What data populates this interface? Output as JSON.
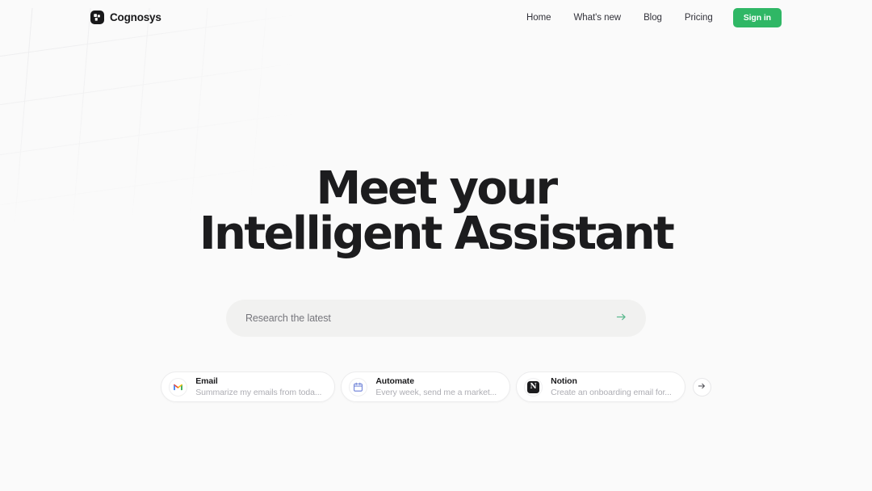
{
  "brand": {
    "name": "Cognosys",
    "logo_icon": "cognosys-pinwheel-icon"
  },
  "nav": {
    "links": [
      {
        "label": "Home"
      },
      {
        "label": "What's new"
      },
      {
        "label": "Blog"
      },
      {
        "label": "Pricing"
      }
    ],
    "signin_label": "Sign in",
    "signin_color": "#2fb765"
  },
  "hero": {
    "headline": "Meet your Intelligent Assistant"
  },
  "search": {
    "placeholder": "Research the latest",
    "value": "",
    "submit_icon": "arrow-right-icon",
    "submit_color": "#5cb98e",
    "background": "#f1f1f0"
  },
  "suggestions": {
    "cards": [
      {
        "icon": "gmail-icon",
        "title": "Email",
        "subtitle": "Summarize my emails from toda..."
      },
      {
        "icon": "calendar-icon",
        "title": "Automate",
        "subtitle": "Every week, send me a market..."
      },
      {
        "icon": "notion-icon",
        "title": "Notion",
        "subtitle": "Create an onboarding email for..."
      }
    ],
    "next_icon": "arrow-right-icon"
  },
  "page": {
    "background": "#fafafa",
    "text_color": "#1c1c1e"
  }
}
